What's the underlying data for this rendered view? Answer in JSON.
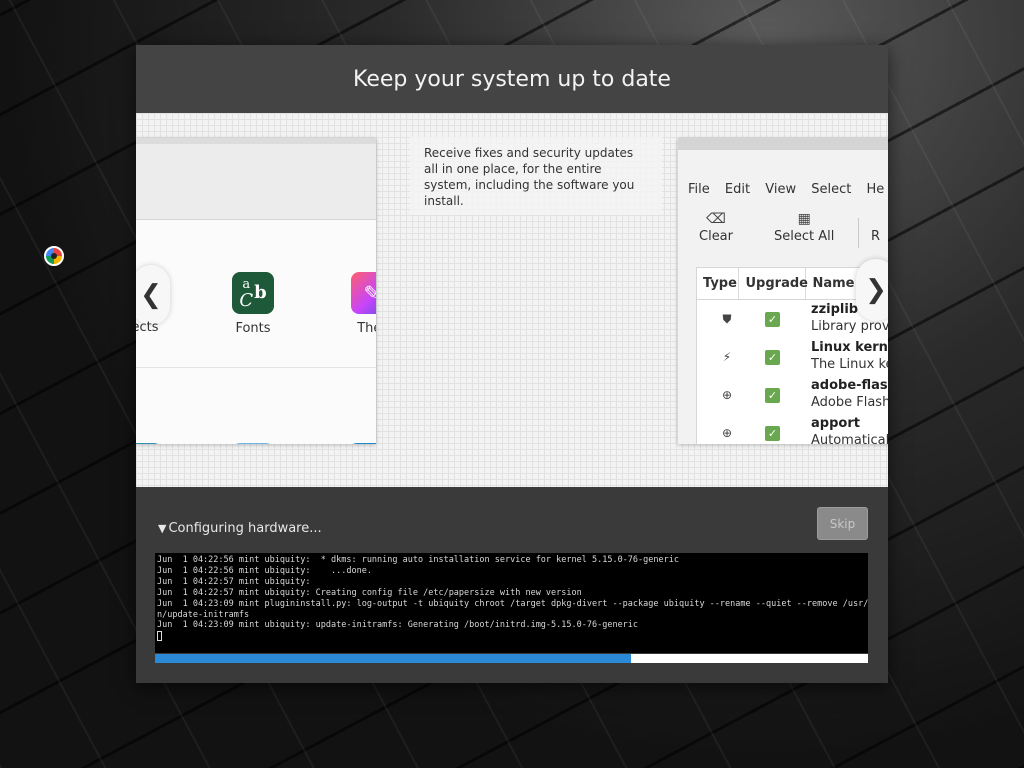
{
  "window": {
    "title": "Keep your system up to date"
  },
  "slide": {
    "text": "Receive fixes and security updates all in one place, for the entire system, including the software you install.",
    "software_manager": {
      "tiles": [
        {
          "label": "ects",
          "icon": "effects-icon"
        },
        {
          "label": "Fonts",
          "icon": "fonts-icon",
          "glyph_top": "a",
          "glyph_mid": "C",
          "glyph_right": "b"
        },
        {
          "label": "Ther",
          "icon": "themes-icon"
        }
      ],
      "prev_arrow": "❮"
    },
    "update_manager": {
      "menu": [
        "File",
        "Edit",
        "View",
        "Select",
        "He"
      ],
      "toolbar": [
        {
          "label": "Clear",
          "icon": "clear-icon",
          "glyph": "⌫"
        },
        {
          "label": "Select All",
          "icon": "select-all-icon",
          "glyph": "▦"
        },
        {
          "label": "R",
          "icon": "refresh-icon",
          "glyph": ""
        }
      ],
      "columns": [
        "Type",
        "Upgrade",
        "Name"
      ],
      "rows": [
        {
          "type_icon": "shield-icon",
          "type_glyph": "⛊",
          "checked": true,
          "name": "zziplib",
          "desc": "Library provi"
        },
        {
          "type_icon": "lightning-icon",
          "type_glyph": "⚡",
          "checked": true,
          "name": "Linux kernel",
          "desc": "The Linux ker"
        },
        {
          "type_icon": "up-arrow-icon",
          "type_glyph": "⊕",
          "checked": true,
          "name": "adobe-flashp",
          "desc": "Adobe Flash"
        },
        {
          "type_icon": "up-arrow-icon",
          "type_glyph": "⊕",
          "checked": true,
          "name": "apport",
          "desc": "Automaticall"
        }
      ],
      "check_glyph": "✓",
      "next_arrow": "❯"
    }
  },
  "status": {
    "toggle_glyph": "▼",
    "label": "Configuring hardware...",
    "skip_label": "Skip"
  },
  "log": [
    "Jun  1 04:22:56 mint ubiquity:  * dkms: running auto installation service for kernel 5.15.0-76-generic",
    "Jun  1 04:22:56 mint ubiquity:    ...done.",
    "Jun  1 04:22:57 mint ubiquity:",
    "Jun  1 04:22:57 mint ubiquity: Creating config file /etc/papersize with new version",
    "Jun  1 04:23:09 mint plugininstall.py: log-output -t ubiquity chroot /target dpkg-divert --package ubiquity --rename --quiet --remove /usr/sbi",
    "n/update-initramfs",
    "Jun  1 04:23:09 mint ubiquity: update-initramfs: Generating /boot/initrd.img-5.15.0-76-generic"
  ],
  "progress": {
    "fraction": 0.667
  },
  "colors": {
    "accent": "#2a8ad8",
    "check": "#6aa84f",
    "title_bar": "#444444"
  }
}
